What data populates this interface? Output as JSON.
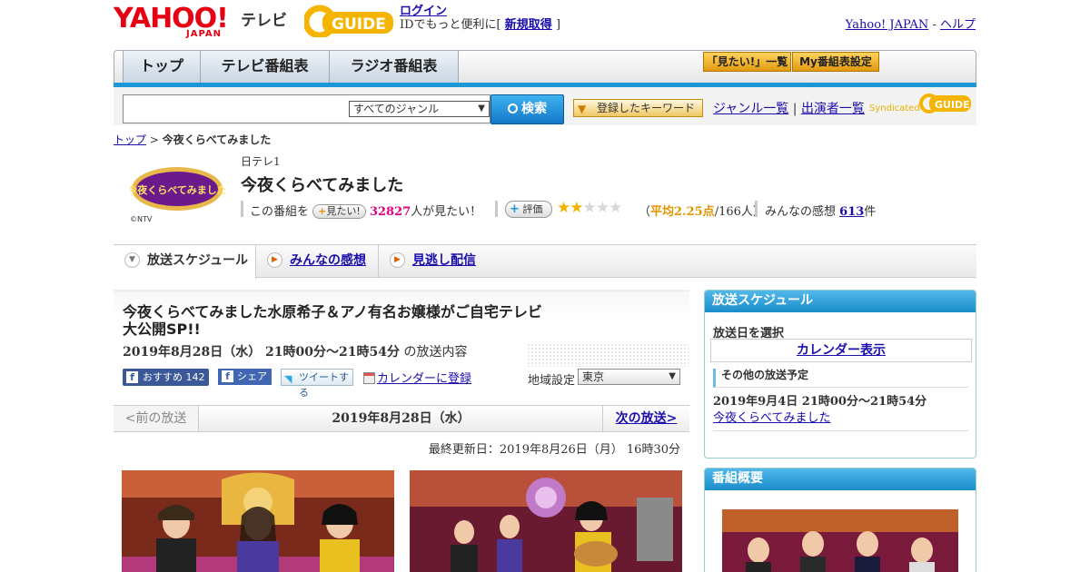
{
  "header": {
    "yahoo_logo": "YAHOO!",
    "yahoo_logo_sub": "JAPAN",
    "tv_label": "テレビ",
    "gguide_logo": "GUIDE",
    "login_label": "ログイン",
    "login_prompt_prefix": "IDでもっと便利に[",
    "register_label": "新規取得",
    "login_prompt_suffix": "]",
    "yahoo_japan_link": "Yahoo! JAPAN",
    "link_separator": "-",
    "help_link": "ヘルプ"
  },
  "nav": {
    "tabs": [
      "トップ",
      "テレビ番組表",
      "ラジオ番組表"
    ],
    "mitai_list": "「見たい!」一覧",
    "my_schedule": "My番組表設定"
  },
  "search": {
    "genre_value": "すべてのジャンル",
    "search_button": "検索",
    "keyword_button": "登録したキーワード",
    "genre_list": "ジャンル一覧",
    "separator": "|",
    "cast_list": "出演者一覧",
    "syndicated": "Syndicated",
    "syndicated_logo": "GUIDE"
  },
  "breadcrumb": {
    "top": "トップ",
    "sep": ">",
    "current": "今夜くらべてみました"
  },
  "program": {
    "channel": "日テレ1",
    "title": "今夜くらべてみました",
    "logo_text": "今夜くらべてみました",
    "copyright": "©NTV",
    "mitai_prefix": "この番組を",
    "mitai_button": "見たい!",
    "mitai_count": "32827",
    "mitai_suffix": "人が見たい！",
    "rate_button": "評価",
    "rating_stars": 2.25,
    "rating_open": "（",
    "rating_avg": "平均2.25点",
    "rating_count": "/166人）",
    "impressions_label": "みんなの感想",
    "impressions_count": "613",
    "impressions_unit": "件"
  },
  "tabs": {
    "schedule": "放送スケジュール",
    "impressions": "みんなの感想",
    "streaming": "見逃し配信"
  },
  "episode": {
    "title": "今夜くらべてみました水原希子＆アノ有名お嬢様がご自宅テレビ大公開SP!!",
    "datetime": "2019年8月28日（水） 21時00分～21時54分",
    "datetime_suffix": "の放送内容",
    "recommend": "おすすめ",
    "recommend_count": "142",
    "share": "シェア",
    "tweet": "ツイートする",
    "calendar_register": "カレンダーに登録",
    "region_label": "地域設定",
    "region_value": "東京"
  },
  "pager": {
    "prev": "<前の放送",
    "current_date": "2019年8月28日（水）",
    "next": "次の放送>"
  },
  "updated": "最終更新日：2019年8月26日（月） 16時30分",
  "sidebar": {
    "schedule_header": "放送スケジュール",
    "date_select_label": "放送日を選択",
    "calendar_display": "カレンダー表示",
    "other_label": "その他の放送予定",
    "other_datetime": "2019年9月4日 21時00分～21時54分",
    "other_title": "今夜くらべてみました",
    "summary_header": "番組概要"
  },
  "colors": {
    "accent_blue": "#1b97d7",
    "yahoo_red": "#e60012",
    "pink_count": "#e3007f",
    "star_gold": "#f0b400"
  }
}
